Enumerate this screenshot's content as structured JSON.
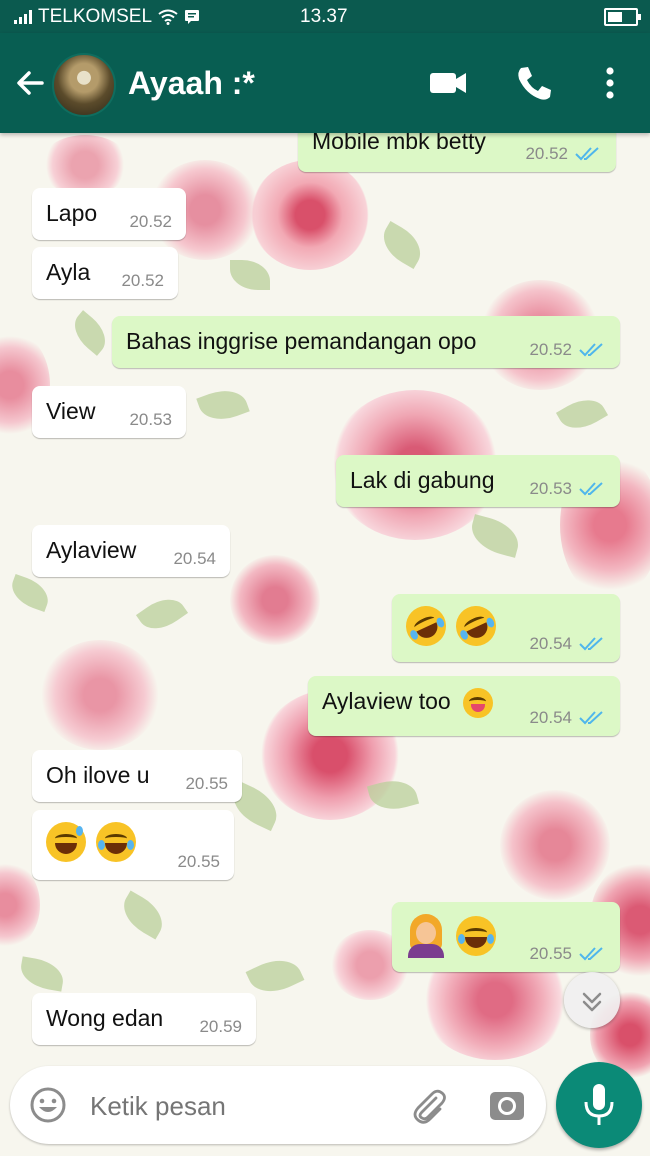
{
  "status_bar": {
    "carrier": "TELKOMSEL",
    "time": "13.37"
  },
  "header": {
    "contact_name": "Ayaah :*"
  },
  "messages": [
    {
      "dir": "out",
      "text": "Mobile mbk betty",
      "time": "20.52",
      "read": true
    },
    {
      "dir": "in",
      "text": "Lapo",
      "time": "20.52"
    },
    {
      "dir": "in",
      "text": "Ayla",
      "time": "20.52"
    },
    {
      "dir": "out",
      "text": "Bahas inggrise pemandangan opo",
      "time": "20.52",
      "read": true
    },
    {
      "dir": "in",
      "text": "View",
      "time": "20.53"
    },
    {
      "dir": "out",
      "text": "Lak di gabung",
      "time": "20.53",
      "read": true
    },
    {
      "dir": "in",
      "text": "Aylaview",
      "time": "20.54"
    },
    {
      "dir": "out",
      "text": "",
      "emoji": [
        "rolling-on-floor-laughing",
        "rolling-on-floor-laughing"
      ],
      "time": "20.54",
      "read": true
    },
    {
      "dir": "out",
      "text": "Aylaview too",
      "emoji": [
        "zany-face"
      ],
      "time": "20.54",
      "read": true
    },
    {
      "dir": "in",
      "text": "Oh ilove u",
      "time": "20.55"
    },
    {
      "dir": "in",
      "text": "",
      "emoji": [
        "grinning-sweat",
        "tears-of-joy"
      ],
      "time": "20.55"
    },
    {
      "dir": "out",
      "text": "",
      "emoji": [
        "woman-facepalming",
        "tears-of-joy"
      ],
      "time": "20.55",
      "read": true
    },
    {
      "dir": "in",
      "text": "Wong edan",
      "time": "20.59"
    }
  ],
  "composer": {
    "placeholder": "Ketik pesan"
  },
  "colors": {
    "header": "#085e52",
    "outgoing_bubble": "#dcf8c6",
    "incoming_bubble": "#ffffff",
    "read_tick": "#4fb6ec",
    "mic_button": "#0b8a77"
  }
}
